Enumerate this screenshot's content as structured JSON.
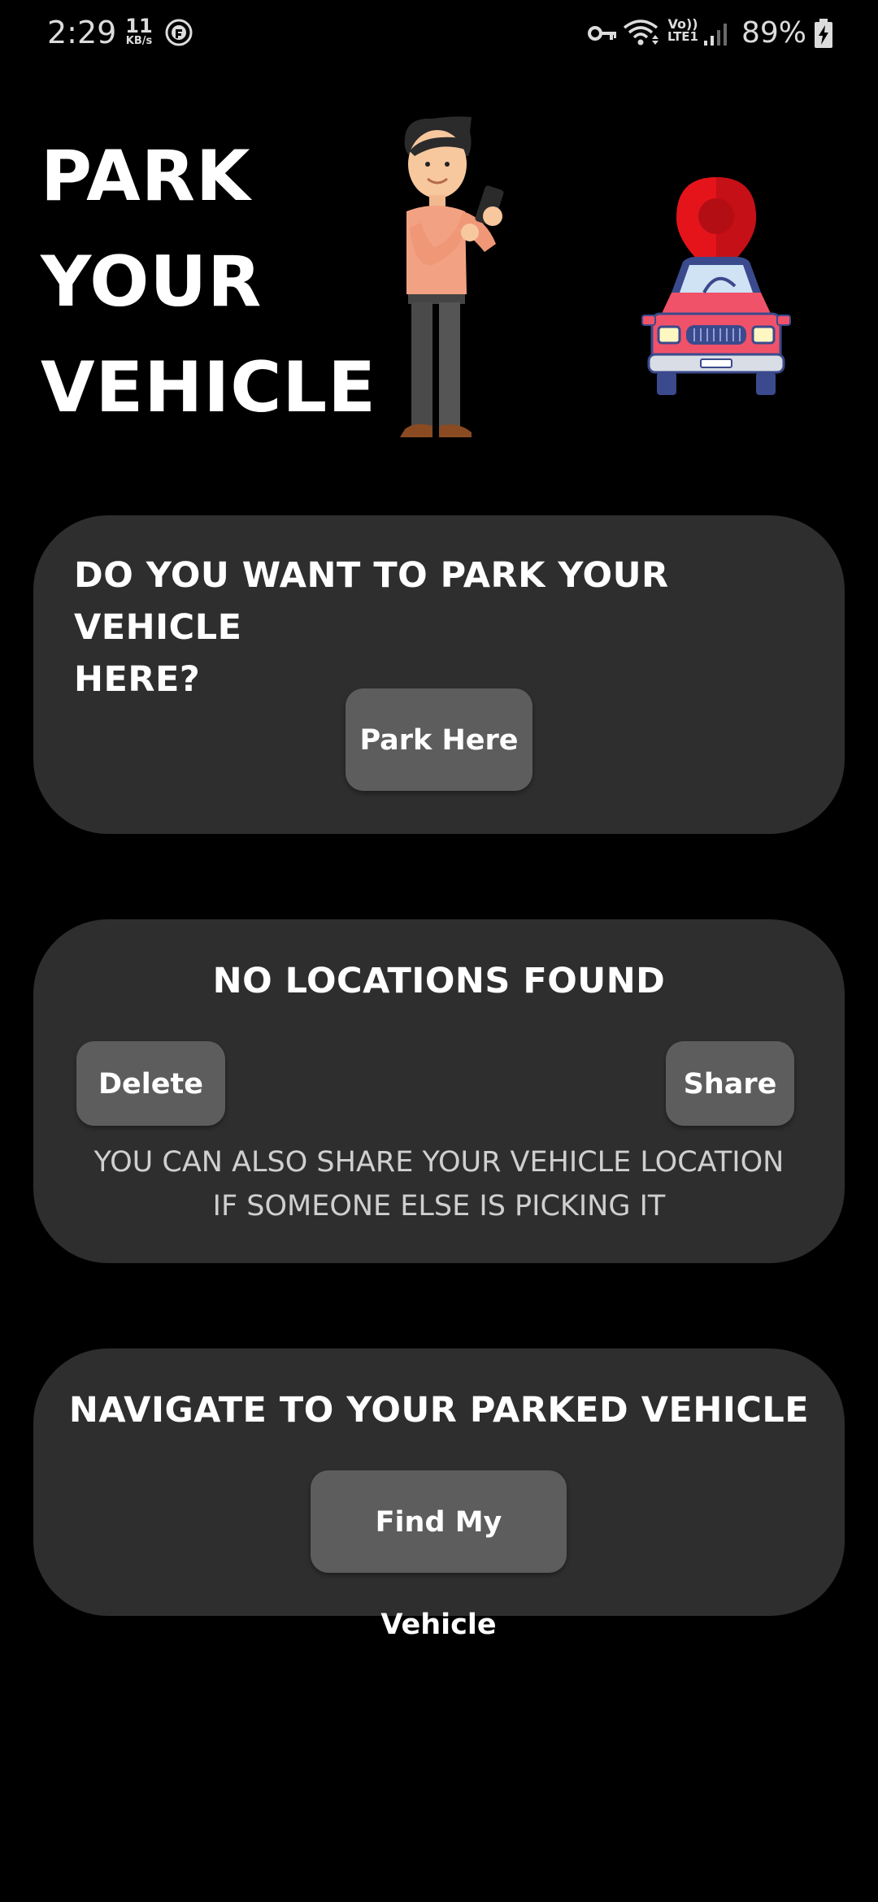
{
  "status_bar": {
    "time": "2:29",
    "net_speed_value": "11",
    "net_speed_unit": "KB/s",
    "volte_top": "Vo))",
    "volte_bottom": "LTE1",
    "battery_percent": "89%"
  },
  "header": {
    "title_lines": [
      "PARK",
      "YOUR",
      "VEHICLE"
    ],
    "pin_color": "#e5141b",
    "car_color": "#f0526a"
  },
  "park_card": {
    "heading_lines": [
      "DO YOU WANT TO PARK YOUR VEHICLE",
      "HERE?"
    ],
    "button_label": "Park Here"
  },
  "locations_card": {
    "heading": "NO LOCATIONS FOUND",
    "delete_label": "Delete",
    "share_label": "Share",
    "hint_lines": [
      "YOU CAN ALSO SHARE YOUR VEHICLE LOCATION",
      "IF SOMEONE ELSE IS PICKING IT"
    ]
  },
  "navigate_card": {
    "heading": "NAVIGATE TO YOUR PARKED VEHICLE",
    "button_label": "Find My Vehicle"
  },
  "colors": {
    "background": "#000000",
    "card": "#2e2e2e",
    "button": "#5d5d5d",
    "text": "#ffffff"
  }
}
